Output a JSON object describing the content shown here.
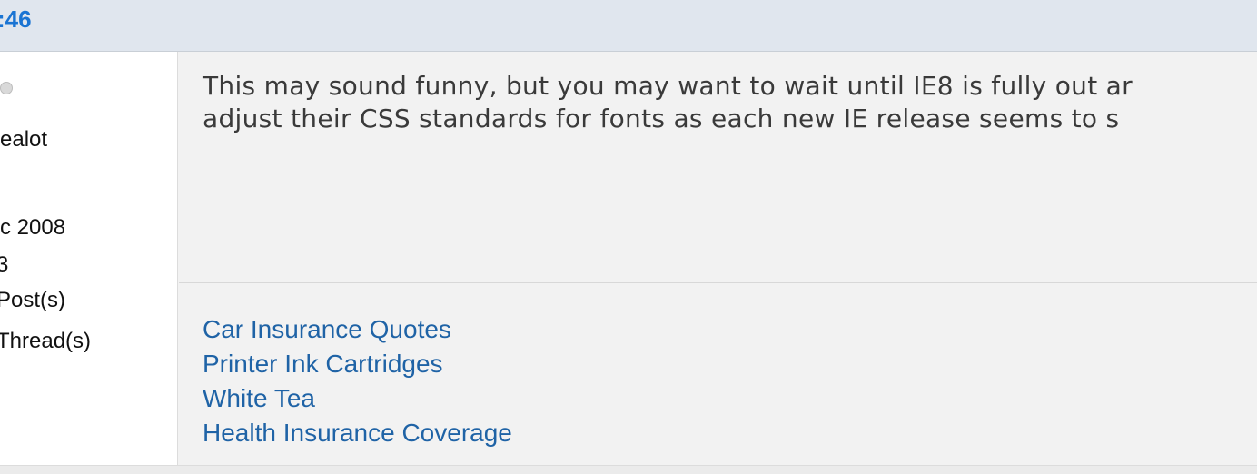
{
  "header": {
    "post_number": ":46"
  },
  "userinfo": {
    "rank": "ealot",
    "join_date": "c 2008",
    "location": "3",
    "posts": "Post(s)",
    "threads": "Thread(s)"
  },
  "post": {
    "lines": [
      "This may sound funny, but you may want to wait until IE8 is fully out ar",
      "adjust their CSS standards for fonts as each new IE release seems to s"
    ]
  },
  "signature": {
    "links": [
      "Car Insurance Quotes",
      "Printer Ink Cartridges",
      "White Tea",
      "Health Insurance Coverage"
    ]
  },
  "colors": {
    "header_bg": "#e0e6ee",
    "post_number": "#1a74d3",
    "link": "#1f63a6",
    "body_text": "#3a3a3a"
  }
}
